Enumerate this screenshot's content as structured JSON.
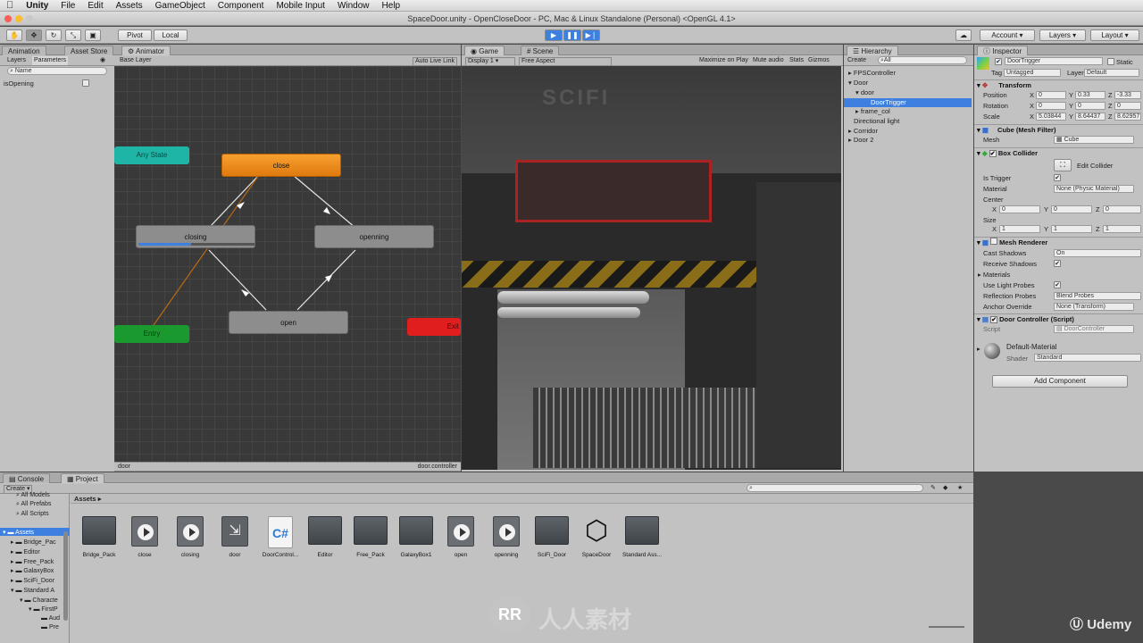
{
  "menubar": {
    "app": "Unity",
    "items": [
      "File",
      "Edit",
      "Assets",
      "GameObject",
      "Component",
      "Mobile Input",
      "Window",
      "Help"
    ]
  },
  "window": {
    "title": "SpaceDoor.unity - OpenCloseDoor - PC, Mac & Linux Standalone (Personal) <OpenGL 4.1>"
  },
  "toolbar": {
    "pivot": "Pivot",
    "local": "Local",
    "account": "Account",
    "layers": "Layers",
    "layout": "Layout"
  },
  "animator_panel": {
    "tabs": [
      "Animation",
      "Asset Store",
      "Animator"
    ],
    "sub_tabs": [
      "Layers",
      "Parameters"
    ],
    "search_placeholder": "Name",
    "parameter": "isOpening",
    "base_layer": "Base Layer",
    "auto_live_link": "Auto Live Link",
    "footer_left": "door",
    "footer_right": "door.controller",
    "states": {
      "any_state": "Any State",
      "close": "close",
      "closing": "closing",
      "openning": "openning",
      "open": "open",
      "entry": "Entry",
      "exit": "Exit"
    },
    "closing_progress": 0.45
  },
  "game_panel": {
    "tabs": [
      "Game",
      "Scene"
    ],
    "display": "Display 1",
    "aspect": "Free Aspect",
    "options": [
      "Maximize on Play",
      "Mute audio",
      "Stats",
      "Gizmos"
    ]
  },
  "hierarchy": {
    "tab": "Hierarchy",
    "create": "Create",
    "search": "All",
    "items": [
      {
        "label": "FPSController",
        "indent": 0
      },
      {
        "label": "Door",
        "indent": 0
      },
      {
        "label": "door",
        "indent": 1
      },
      {
        "label": "DoorTrigger",
        "indent": 2,
        "selected": true
      },
      {
        "label": "frame_col",
        "indent": 1
      },
      {
        "label": "Directional light",
        "indent": 0
      },
      {
        "label": "Corridor",
        "indent": 0
      },
      {
        "label": "Door 2",
        "indent": 0
      }
    ]
  },
  "inspector": {
    "tab": "Inspector",
    "object_name": "DoorTrigger",
    "static": "Static",
    "tag_label": "Tag",
    "tag": "Untagged",
    "layer_label": "Layer",
    "layer": "Default",
    "transform": {
      "title": "Transform",
      "position": [
        "0",
        "0.33",
        "-3.33"
      ],
      "rotation": [
        "0",
        "0",
        "0"
      ],
      "scale": [
        "5.03844",
        "8.64437",
        "8.62957"
      ]
    },
    "mesh_filter": {
      "title": "Cube (Mesh Filter)",
      "mesh_label": "Mesh",
      "mesh": "Cube"
    },
    "box_collider": {
      "title": "Box Collider",
      "edit_collider": "Edit Collider",
      "is_trigger": "Is Trigger",
      "material_label": "Material",
      "material": "None (Physic Material)",
      "center_label": "Center",
      "center": [
        "0",
        "0",
        "0"
      ],
      "size_label": "Size",
      "size": [
        "1",
        "1",
        "1"
      ]
    },
    "mesh_renderer": {
      "title": "Mesh Renderer",
      "cast_shadows_label": "Cast Shadows",
      "cast_shadows": "On",
      "receive_shadows": "Receive Shadows",
      "materials": "Materials",
      "light_probes": "Use Light Probes",
      "reflection_label": "Reflection Probes",
      "reflection": "Blend Probes",
      "anchor_label": "Anchor Override",
      "anchor": "None (Transform)"
    },
    "door_controller": {
      "title": "Door Controller (Script)",
      "script_label": "Script",
      "script": "DoorController"
    },
    "material": {
      "name": "Default-Material",
      "shader_label": "Shader",
      "shader": "Standard"
    },
    "add_component": "Add Component",
    "axis": [
      "X",
      "Y",
      "Z"
    ],
    "row_labels": [
      "Position",
      "Rotation",
      "Scale"
    ]
  },
  "project": {
    "tabs": [
      "Console",
      "Project"
    ],
    "create": "Create",
    "favorites": [
      "All Models",
      "All Prefabs",
      "All Scripts"
    ],
    "tree": [
      "Assets",
      "Bridge_Pac",
      "Editor",
      "Free_Pack",
      "GalaxyBox",
      "SciFi_Door",
      "Standard A",
      "Characte",
      "FirstP",
      "Aud",
      "Pre"
    ],
    "breadcrumb": "Assets",
    "assets": [
      {
        "name": "Bridge_Pack",
        "kind": "folder"
      },
      {
        "name": "close",
        "kind": "anim"
      },
      {
        "name": "closing",
        "kind": "anim"
      },
      {
        "name": "door",
        "kind": "controller"
      },
      {
        "name": "DoorControl...",
        "kind": "script"
      },
      {
        "name": "Editor",
        "kind": "folder"
      },
      {
        "name": "Free_Pack",
        "kind": "folder"
      },
      {
        "name": "GalaxyBox1",
        "kind": "folder"
      },
      {
        "name": "open",
        "kind": "anim"
      },
      {
        "name": "openning",
        "kind": "anim"
      },
      {
        "name": "SciFi_Door",
        "kind": "folder"
      },
      {
        "name": "SpaceDoor",
        "kind": "unity"
      },
      {
        "name": "Standard Ass...",
        "kind": "folder"
      }
    ]
  },
  "watermarks": {
    "site": "人人素材",
    "brand": "Udemy",
    "mark_left": "RR",
    "scene_text": "SCIFI"
  },
  "colors": {
    "state_orange": "#f08a1a",
    "state_teal": "#1fb5a6",
    "state_green": "#1a9a2e",
    "state_red": "#e01e1e",
    "state_gray": "#8d8d8d",
    "selection": "#3d80df"
  }
}
